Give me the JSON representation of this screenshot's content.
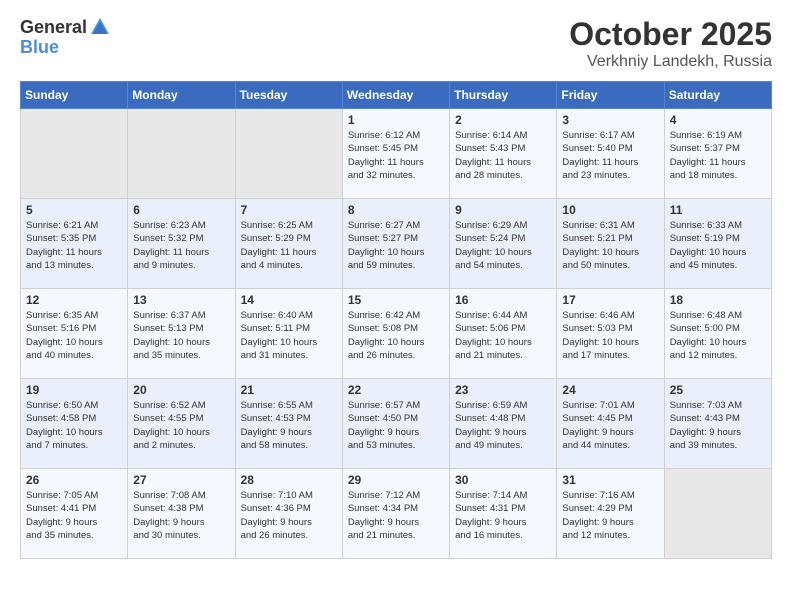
{
  "header": {
    "logo_general": "General",
    "logo_blue": "Blue",
    "month": "October 2025",
    "location": "Verkhniy Landekh, Russia"
  },
  "days_of_week": [
    "Sunday",
    "Monday",
    "Tuesday",
    "Wednesday",
    "Thursday",
    "Friday",
    "Saturday"
  ],
  "weeks": [
    [
      {
        "day": "",
        "content": ""
      },
      {
        "day": "",
        "content": ""
      },
      {
        "day": "",
        "content": ""
      },
      {
        "day": "1",
        "content": "Sunrise: 6:12 AM\nSunset: 5:45 PM\nDaylight: 11 hours\nand 32 minutes."
      },
      {
        "day": "2",
        "content": "Sunrise: 6:14 AM\nSunset: 5:43 PM\nDaylight: 11 hours\nand 28 minutes."
      },
      {
        "day": "3",
        "content": "Sunrise: 6:17 AM\nSunset: 5:40 PM\nDaylight: 11 hours\nand 23 minutes."
      },
      {
        "day": "4",
        "content": "Sunrise: 6:19 AM\nSunset: 5:37 PM\nDaylight: 11 hours\nand 18 minutes."
      }
    ],
    [
      {
        "day": "5",
        "content": "Sunrise: 6:21 AM\nSunset: 5:35 PM\nDaylight: 11 hours\nand 13 minutes."
      },
      {
        "day": "6",
        "content": "Sunrise: 6:23 AM\nSunset: 5:32 PM\nDaylight: 11 hours\nand 9 minutes."
      },
      {
        "day": "7",
        "content": "Sunrise: 6:25 AM\nSunset: 5:29 PM\nDaylight: 11 hours\nand 4 minutes."
      },
      {
        "day": "8",
        "content": "Sunrise: 6:27 AM\nSunset: 5:27 PM\nDaylight: 10 hours\nand 59 minutes."
      },
      {
        "day": "9",
        "content": "Sunrise: 6:29 AM\nSunset: 5:24 PM\nDaylight: 10 hours\nand 54 minutes."
      },
      {
        "day": "10",
        "content": "Sunrise: 6:31 AM\nSunset: 5:21 PM\nDaylight: 10 hours\nand 50 minutes."
      },
      {
        "day": "11",
        "content": "Sunrise: 6:33 AM\nSunset: 5:19 PM\nDaylight: 10 hours\nand 45 minutes."
      }
    ],
    [
      {
        "day": "12",
        "content": "Sunrise: 6:35 AM\nSunset: 5:16 PM\nDaylight: 10 hours\nand 40 minutes."
      },
      {
        "day": "13",
        "content": "Sunrise: 6:37 AM\nSunset: 5:13 PM\nDaylight: 10 hours\nand 35 minutes."
      },
      {
        "day": "14",
        "content": "Sunrise: 6:40 AM\nSunset: 5:11 PM\nDaylight: 10 hours\nand 31 minutes."
      },
      {
        "day": "15",
        "content": "Sunrise: 6:42 AM\nSunset: 5:08 PM\nDaylight: 10 hours\nand 26 minutes."
      },
      {
        "day": "16",
        "content": "Sunrise: 6:44 AM\nSunset: 5:06 PM\nDaylight: 10 hours\nand 21 minutes."
      },
      {
        "day": "17",
        "content": "Sunrise: 6:46 AM\nSunset: 5:03 PM\nDaylight: 10 hours\nand 17 minutes."
      },
      {
        "day": "18",
        "content": "Sunrise: 6:48 AM\nSunset: 5:00 PM\nDaylight: 10 hours\nand 12 minutes."
      }
    ],
    [
      {
        "day": "19",
        "content": "Sunrise: 6:50 AM\nSunset: 4:58 PM\nDaylight: 10 hours\nand 7 minutes."
      },
      {
        "day": "20",
        "content": "Sunrise: 6:52 AM\nSunset: 4:55 PM\nDaylight: 10 hours\nand 2 minutes."
      },
      {
        "day": "21",
        "content": "Sunrise: 6:55 AM\nSunset: 4:53 PM\nDaylight: 9 hours\nand 58 minutes."
      },
      {
        "day": "22",
        "content": "Sunrise: 6:57 AM\nSunset: 4:50 PM\nDaylight: 9 hours\nand 53 minutes."
      },
      {
        "day": "23",
        "content": "Sunrise: 6:59 AM\nSunset: 4:48 PM\nDaylight: 9 hours\nand 49 minutes."
      },
      {
        "day": "24",
        "content": "Sunrise: 7:01 AM\nSunset: 4:45 PM\nDaylight: 9 hours\nand 44 minutes."
      },
      {
        "day": "25",
        "content": "Sunrise: 7:03 AM\nSunset: 4:43 PM\nDaylight: 9 hours\nand 39 minutes."
      }
    ],
    [
      {
        "day": "26",
        "content": "Sunrise: 7:05 AM\nSunset: 4:41 PM\nDaylight: 9 hours\nand 35 minutes."
      },
      {
        "day": "27",
        "content": "Sunrise: 7:08 AM\nSunset: 4:38 PM\nDaylight: 9 hours\nand 30 minutes."
      },
      {
        "day": "28",
        "content": "Sunrise: 7:10 AM\nSunset: 4:36 PM\nDaylight: 9 hours\nand 26 minutes."
      },
      {
        "day": "29",
        "content": "Sunrise: 7:12 AM\nSunset: 4:34 PM\nDaylight: 9 hours\nand 21 minutes."
      },
      {
        "day": "30",
        "content": "Sunrise: 7:14 AM\nSunset: 4:31 PM\nDaylight: 9 hours\nand 16 minutes."
      },
      {
        "day": "31",
        "content": "Sunrise: 7:16 AM\nSunset: 4:29 PM\nDaylight: 9 hours\nand 12 minutes."
      },
      {
        "day": "",
        "content": ""
      }
    ]
  ]
}
